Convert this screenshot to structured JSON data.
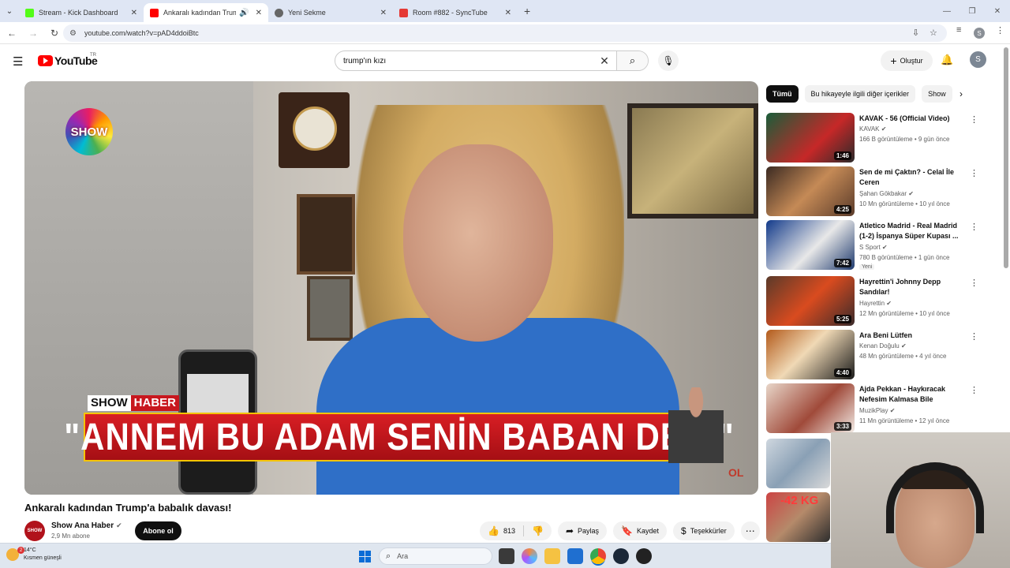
{
  "browser": {
    "tabs": [
      {
        "title": "Stream - Kick Dashboard",
        "favicon_color": "#53fc18",
        "active": false
      },
      {
        "title": "Ankaralı kadından Trump'a",
        "favicon_color": "#ff0000",
        "active": true
      },
      {
        "title": "Yeni Sekme",
        "favicon_color": "#666666",
        "active": false
      },
      {
        "title": "Room #882 - SyncTube",
        "favicon_color": "#e53935",
        "active": false
      }
    ],
    "url": "youtube.com/watch?v=pAD4ddoiBtc"
  },
  "youtube": {
    "logo_text": "YouTube",
    "country_code": "TR",
    "search_query": "trump'ın kızı",
    "create_label": "Oluştur",
    "avatar_letter": "S"
  },
  "video": {
    "overlay_brand": "SHOW",
    "chyron_tag_a": "SHOW",
    "chyron_tag_b": "HABER",
    "chyron_text": "\"ANNEM BU ADAM SENİN BABAN DEDİ\"",
    "watermark": "OL",
    "title": "Ankaralı kadından Trump'a babalık davası!",
    "channel_name": "Show Ana Haber",
    "channel_avatar_text": "SHOW",
    "subscribers": "2,9 Mn abone",
    "subscribe_label": "Abone ol",
    "likes": "813",
    "share_label": "Paylaş",
    "save_label": "Kaydet",
    "thanks_label": "Teşekkürler"
  },
  "chips": [
    "Tümü",
    "Bu hikayeyle ilgili diğer içerikler",
    "Show"
  ],
  "related": [
    {
      "title": "KAVAK - 56 (Official Video)",
      "channel": "KAVAK",
      "stats": "166 B görüntüleme • 9 gün önce",
      "duration": "1:46",
      "verified": true
    },
    {
      "title": "Sen de mi Çaktın? - Celal İle Ceren",
      "channel": "Şahan Gökbakar",
      "stats": "10 Mn görüntüleme • 10 yıl önce",
      "duration": "4:25",
      "verified": true
    },
    {
      "title": "Atletico Madrid - Real Madrid (1-2) İspanya Süper Kupası ...",
      "channel": "S Sport",
      "stats": "780 B görüntüleme • 1 gün önce",
      "duration": "7:42",
      "verified": true,
      "badge": "Yeni"
    },
    {
      "title": "Hayrettin'i Johnny Depp Sandılar!",
      "channel": "Hayrettin",
      "stats": "12 Mn görüntüleme • 10 yıl önce",
      "duration": "5:25",
      "verified": true
    },
    {
      "title": "Ara Beni Lütfen",
      "channel": "Kenan Doğulu",
      "stats": "48 Mn görüntüleme • 4 yıl önce",
      "duration": "4:40",
      "verified": true
    },
    {
      "title": "Ajda Pekkan - Haykıracak Nefesim Kalmasa Bile (Official...",
      "channel": "MuzikPlay",
      "stats": "11 Mn görüntüleme • 12 yıl önce",
      "duration": "3:33",
      "verified": true
    }
  ],
  "related_partial": {
    "badge_text": "-42 KG"
  },
  "taskbar": {
    "temp": "14°C",
    "weather": "Kısmen güneşli",
    "notification_count": "2",
    "search_placeholder": "Ara"
  }
}
